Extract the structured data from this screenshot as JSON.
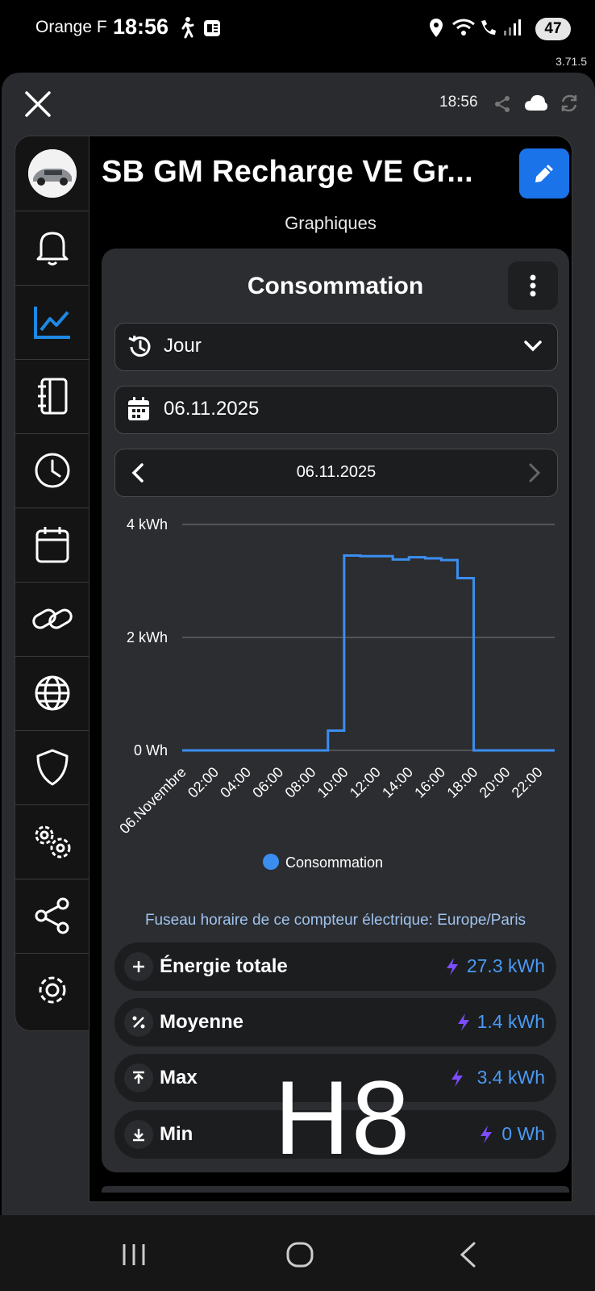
{
  "status_bar": {
    "carrier": "Orange F",
    "time": "18:56",
    "battery": "47"
  },
  "app_version": "3.71.5",
  "top_bar": {
    "time": "18:56"
  },
  "header": {
    "title": "SB GM Recharge VE Gr...",
    "subtitle": "Graphiques"
  },
  "card": {
    "title": "Consommation",
    "period_select": "Jour",
    "date_field": "06.11.2025",
    "nav_date": "06.11.2025",
    "timezone_note": "Fuseau horaire de ce compteur électrique: Europe/Paris"
  },
  "stats": [
    {
      "icon": "+",
      "label": "Énergie totale",
      "value": "27.3 kWh"
    },
    {
      "icon": "%",
      "label": "Moyenne",
      "value": "1.4 kWh"
    },
    {
      "icon": "max-arrow",
      "label": "Max",
      "value": "3.4 kWh"
    },
    {
      "icon": "min-arrow",
      "label": "Min",
      "value": "0 Wh"
    }
  ],
  "overlay_text": "H8",
  "colors": {
    "accent": "#1a73e8",
    "series": "#3b8ef0",
    "background": "#000000",
    "card": "#2c2d30"
  },
  "chart_data": {
    "type": "line",
    "step": true,
    "yticks": [
      "0 Wh",
      "2 kWh",
      "4 kWh"
    ],
    "ylim": [
      0,
      4
    ],
    "xticks": [
      "06.Novembre",
      "02:00",
      "04:00",
      "06:00",
      "08:00",
      "10:00",
      "12:00",
      "14:00",
      "16:00",
      "18:00",
      "20:00",
      "22:00"
    ],
    "xlim": [
      0,
      23
    ],
    "grid": true,
    "legend_position": "bottom",
    "series": [
      {
        "name": "Consommation",
        "x": [
          0,
          1,
          2,
          3,
          4,
          5,
          6,
          7,
          8,
          9,
          10,
          11,
          12,
          13,
          14,
          15,
          16,
          17,
          18,
          19,
          20,
          21,
          22,
          23
        ],
        "values": [
          0,
          0,
          0,
          0,
          0,
          0,
          0,
          0,
          0,
          0.35,
          3.45,
          3.44,
          3.44,
          3.38,
          3.42,
          3.4,
          3.37,
          3.05,
          0,
          0,
          0,
          0,
          0,
          0
        ]
      }
    ]
  }
}
